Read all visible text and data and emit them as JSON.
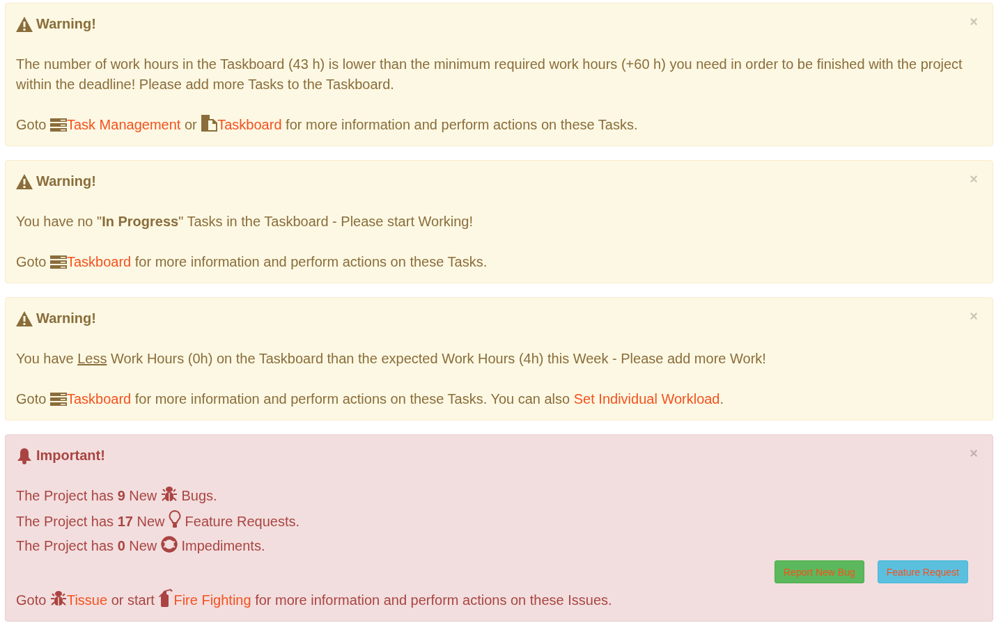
{
  "alerts": [
    {
      "kind": "warning",
      "title": "Warning!",
      "close": "×",
      "message_lines": [
        [
          {
            "kind": "text",
            "text": "The number of work hours in the Taskboard (43 h) is lower than the minimum required work hours (+60 h) you need in order to be finished with the project within the deadline! Please add more Tasks to the Taskboard."
          }
        ]
      ],
      "goto": [
        {
          "kind": "text",
          "text": "Goto "
        },
        {
          "kind": "tasks_icon"
        },
        {
          "kind": "link",
          "text": "Task Management"
        },
        {
          "kind": "text",
          "text": " or "
        },
        {
          "kind": "copy_icon"
        },
        {
          "kind": "link",
          "text": "Taskboard"
        },
        {
          "kind": "text",
          "text": " for more information and perform actions on these Tasks."
        }
      ]
    },
    {
      "kind": "warning",
      "title": "Warning!",
      "close": "×",
      "message_lines": [
        [
          {
            "kind": "text",
            "text": "You have no \""
          },
          {
            "kind": "bold",
            "text": "In Progress"
          },
          {
            "kind": "text",
            "text": "\" Tasks in the Taskboard - Please start Working!"
          }
        ]
      ],
      "goto": [
        {
          "kind": "text",
          "text": "Goto "
        },
        {
          "kind": "tasks_icon"
        },
        {
          "kind": "link",
          "text": "Taskboard"
        },
        {
          "kind": "text",
          "text": " for more information and perform actions on these Tasks."
        }
      ]
    },
    {
      "kind": "warning",
      "title": "Warning!",
      "close": "×",
      "message_lines": [
        [
          {
            "kind": "text",
            "text": "You have "
          },
          {
            "kind": "underline",
            "text": "Less"
          },
          {
            "kind": "text",
            "text": " Work Hours (0h) on the Taskboard than the expected Work Hours (4h) this Week - Please add more Work!"
          }
        ]
      ],
      "goto": [
        {
          "kind": "text",
          "text": "Goto "
        },
        {
          "kind": "tasks_icon"
        },
        {
          "kind": "link",
          "text": "Taskboard"
        },
        {
          "kind": "text",
          "text": " for more information and perform actions on these Tasks. You can also "
        },
        {
          "kind": "link",
          "text": "Set Individual Workload"
        },
        {
          "kind": "text",
          "text": "."
        }
      ]
    },
    {
      "kind": "danger",
      "title": "Important!",
      "close": "×",
      "message_lines": [
        [
          {
            "kind": "text",
            "text": "The Project has "
          },
          {
            "kind": "bold",
            "text": "9"
          },
          {
            "kind": "text",
            "text": " New "
          },
          {
            "kind": "bug_icon"
          },
          {
            "kind": "text",
            "text": " Bugs."
          }
        ],
        [
          {
            "kind": "text",
            "text": "The Project has "
          },
          {
            "kind": "bold",
            "text": "17"
          },
          {
            "kind": "text",
            "text": " New "
          },
          {
            "kind": "bulb_icon"
          },
          {
            "kind": "text",
            "text": " Feature Requests."
          }
        ],
        [
          {
            "kind": "text",
            "text": "The Project has "
          },
          {
            "kind": "bold",
            "text": "0"
          },
          {
            "kind": "text",
            "text": " New "
          },
          {
            "kind": "lifebuoy_icon"
          },
          {
            "kind": "text",
            "text": " Impediments."
          }
        ]
      ],
      "buttons": [
        {
          "kind": "success",
          "label": "Report New Bug"
        },
        {
          "kind": "info",
          "label": "Feature Request"
        }
      ],
      "goto": [
        {
          "kind": "text",
          "text": "Goto "
        },
        {
          "kind": "bug_icon"
        },
        {
          "kind": "link",
          "text": "Tissue"
        },
        {
          "kind": "text",
          "text": " or start "
        },
        {
          "kind": "extinguisher_icon"
        },
        {
          "kind": "link",
          "text": "Fire Fighting"
        },
        {
          "kind": "text",
          "text": " for more information and perform actions on these Issues."
        }
      ]
    }
  ]
}
